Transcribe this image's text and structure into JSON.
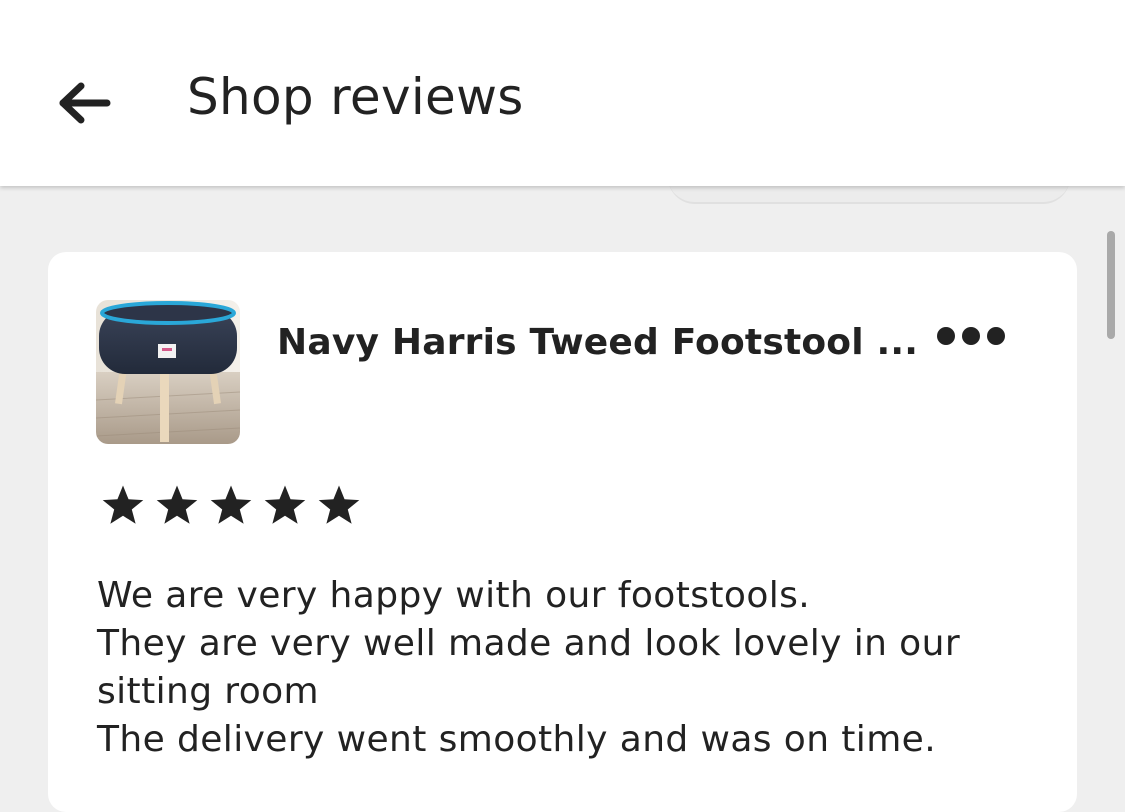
{
  "header": {
    "title": "Shop reviews",
    "back_icon": "arrow-left-icon"
  },
  "review": {
    "item_title": "Navy Harris Tweed Footstool ...",
    "item_meta": "",
    "thumbnail": "footstool-product-image",
    "more_icon": "more-horizontal-icon",
    "rating": 5,
    "rating_max": 5,
    "text_lines": [
      "We are very happy with our footstools.",
      "They are very well made and look lovely in our",
      "sitting room",
      "The delivery went smoothly and was on time."
    ]
  },
  "colors": {
    "background": "#efefef",
    "card": "#ffffff",
    "text": "#222222",
    "scrollbar": "#a9a9a9"
  }
}
